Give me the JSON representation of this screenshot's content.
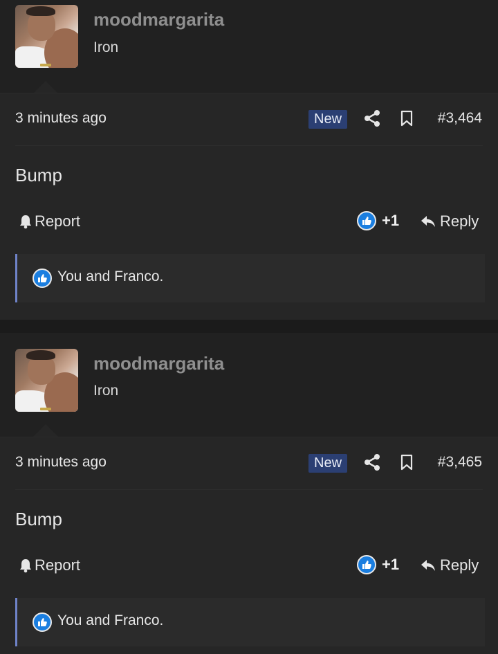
{
  "posts": [
    {
      "username": "moodmargarita",
      "user_title": "Iron",
      "time": "3 minutes ago",
      "badge": "New",
      "post_number": "#3,464",
      "content": "Bump",
      "report_label": "Report",
      "like_count": "+1",
      "reply_label": "Reply",
      "likes_text": "You and Franco."
    },
    {
      "username": "moodmargarita",
      "user_title": "Iron",
      "time": "3 minutes ago",
      "badge": "New",
      "post_number": "#3,465",
      "content": "Bump",
      "report_label": "Report",
      "like_count": "+1",
      "reply_label": "Reply",
      "likes_text": "You and Franco."
    }
  ],
  "colors": {
    "badge_bg": "#2b3f73",
    "like_blue": "#1a7ee0",
    "username": "#8f8f8f",
    "accent_border": "#6f83c9"
  },
  "icons": [
    "share-icon",
    "bookmark-icon",
    "bell-icon",
    "like-icon",
    "reply-icon"
  ]
}
